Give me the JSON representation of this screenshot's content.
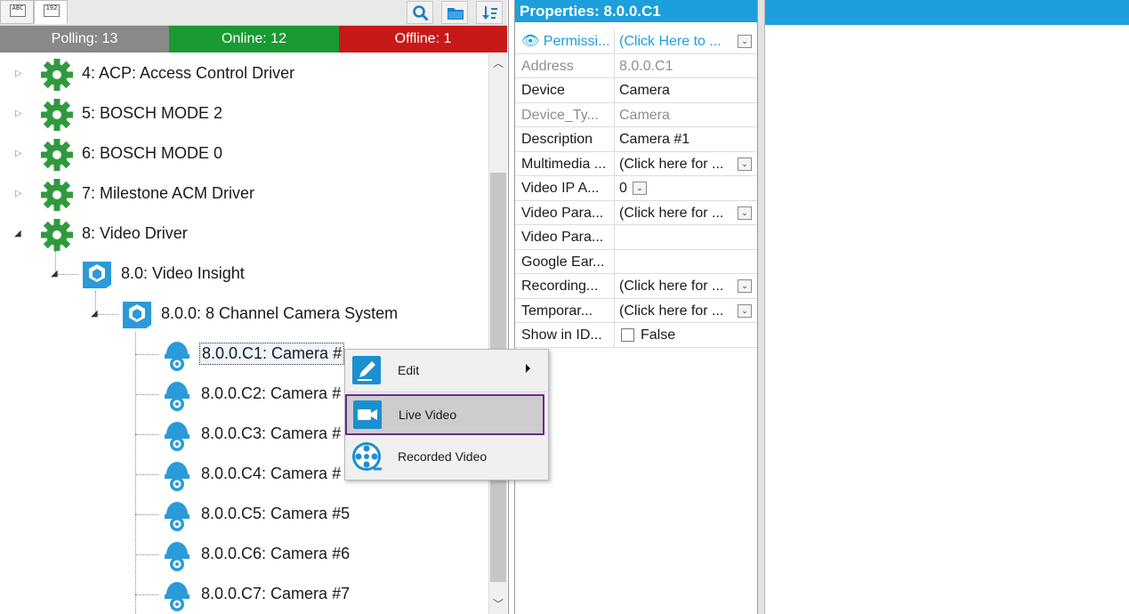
{
  "toolbar": {
    "tab_abc_glyph": "ABC",
    "tab_num_glyph": "192",
    "buttons": [
      "search-icon",
      "folder-icon",
      "sort-icon"
    ]
  },
  "status": {
    "polling": "Polling: 13",
    "online": "Online: 12",
    "offline": "Offline: 1"
  },
  "tree": {
    "drivers": [
      {
        "label": "4:  ACP: Access Control Driver"
      },
      {
        "label": "5:  BOSCH MODE 2"
      },
      {
        "label": "6:  BOSCH MODE 0"
      },
      {
        "label": "7:  Milestone ACM Driver"
      },
      {
        "label": "8:  Video Driver"
      }
    ],
    "subsystem": {
      "label": "8.0:  Video Insight"
    },
    "system": {
      "label": "8.0.0:  8 Channel Camera System"
    },
    "cameras": [
      {
        "label": "8.0.0.C1:  Camera #"
      },
      {
        "label": "8.0.0.C2:  Camera #"
      },
      {
        "label": "8.0.0.C3:  Camera #"
      },
      {
        "label": "8.0.0.C4:  Camera #"
      },
      {
        "label": "8.0.0.C5:  Camera #5"
      },
      {
        "label": "8.0.0.C6:  Camera #6"
      },
      {
        "label": "8.0.0.C7:  Camera #7"
      }
    ]
  },
  "context_menu": {
    "edit": "Edit",
    "live_video": "Live Video",
    "recorded_video": "Recorded Video"
  },
  "properties": {
    "title": "Properties:  8.0.0.C1",
    "rows": [
      {
        "name": "Permissi...",
        "value": "(Click Here to ...",
        "dropdown": true,
        "style": "link"
      },
      {
        "name": "Address",
        "value": "8.0.0.C1",
        "dropdown": false,
        "style": "dim"
      },
      {
        "name": "Device",
        "value": "Camera",
        "dropdown": false,
        "style": "normal"
      },
      {
        "name": "Device_Ty...",
        "value": "Camera",
        "dropdown": false,
        "style": "dim"
      },
      {
        "name": "Description",
        "value": "Camera #1",
        "dropdown": false,
        "style": "normal"
      },
      {
        "name": "Multimedia ...",
        "value": "(Click here for ...",
        "dropdown": true,
        "style": "normal"
      },
      {
        "name": "Video IP A...",
        "value": "0",
        "dropdown": true,
        "style": "normal"
      },
      {
        "name": "Video Para...",
        "value": "(Click here for ...",
        "dropdown": true,
        "style": "normal"
      },
      {
        "name": "Video Para...",
        "value": "",
        "dropdown": false,
        "style": "normal"
      },
      {
        "name": "Google Ear...",
        "value": "",
        "dropdown": false,
        "style": "normal"
      },
      {
        "name": "Recording...",
        "value": "(Click here for ...",
        "dropdown": true,
        "style": "normal"
      },
      {
        "name": "Temporar...",
        "value": "(Click here for ...",
        "dropdown": true,
        "style": "normal"
      },
      {
        "name": "Show in ID...",
        "value": "False",
        "dropdown": false,
        "checkbox": true,
        "style": "normal"
      }
    ]
  },
  "colors": {
    "accent_blue": "#1c9fdc",
    "online_green": "#1a9a33",
    "offline_red": "#c71a18",
    "polling_gray": "#898989",
    "gear_green": "#2f9a3d",
    "camera_blue": "#2a9ad8",
    "menu_highlight_border": "#6a2a8a"
  }
}
